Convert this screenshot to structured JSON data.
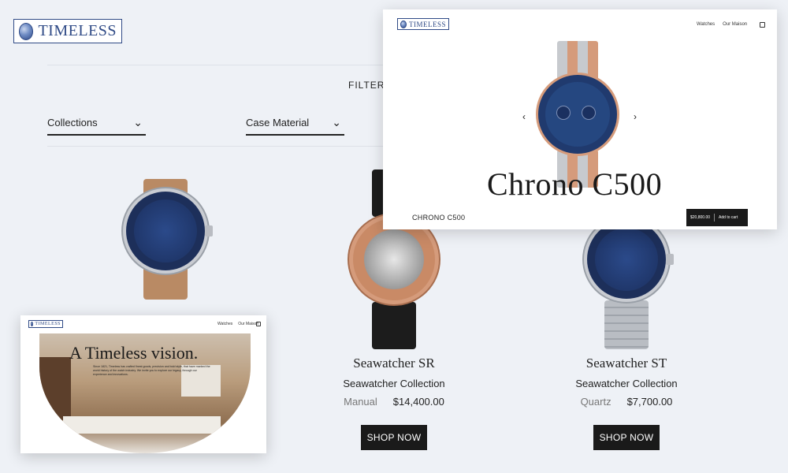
{
  "main": {
    "brand": "TIMELESS",
    "filter_title": "FILTER YO",
    "filters": [
      {
        "label": "Collections"
      },
      {
        "label": "Case Material"
      }
    ],
    "products": [
      {
        "name": "",
        "collection": "",
        "movement": "",
        "price": "",
        "shop": "",
        "strap": "leather-brown"
      },
      {
        "name": "Seawatcher SR",
        "collection": "Seawatcher Collection",
        "movement": "Manual",
        "price": "$14,400.00",
        "shop": "SHOP NOW",
        "strap": "leather-black"
      },
      {
        "name": "Seawatcher ST",
        "collection": "Seawatcher Collection",
        "movement": "Quartz",
        "price": "$7,700.00",
        "shop": "SHOP NOW",
        "strap": "steel-bracelet"
      }
    ]
  },
  "overlay_product": {
    "brand": "TIMELESS",
    "nav": [
      "Watches",
      "Our Maison"
    ],
    "cart_icon": "shopping-bag-icon",
    "hero_title": "Chrono C500",
    "product_name": "CHRONO C500",
    "price": "$20,800.00",
    "add_to_cart": "Add to cart",
    "prev_arrow": "‹",
    "next_arrow": "›"
  },
  "overlay_maison": {
    "brand": "TIMELESS",
    "nav": [
      "Watches",
      "Our Maison"
    ],
    "cart_icon": "shopping-bag-icon",
    "hero_title": "A Timeless vision.",
    "hero_text": "Since 1821, Timeless has crafted finest goods, precision and bold style, that have marked the world history of the watch industry. We invite you to explore our legacy, through our experience and innovations."
  },
  "colors": {
    "background": "#eef1f6",
    "brand_blue": "#2f4a86",
    "button_black": "#1a1a1a",
    "dial_blue": "#1b2f5e",
    "rose_gold": "#d59b7b"
  }
}
